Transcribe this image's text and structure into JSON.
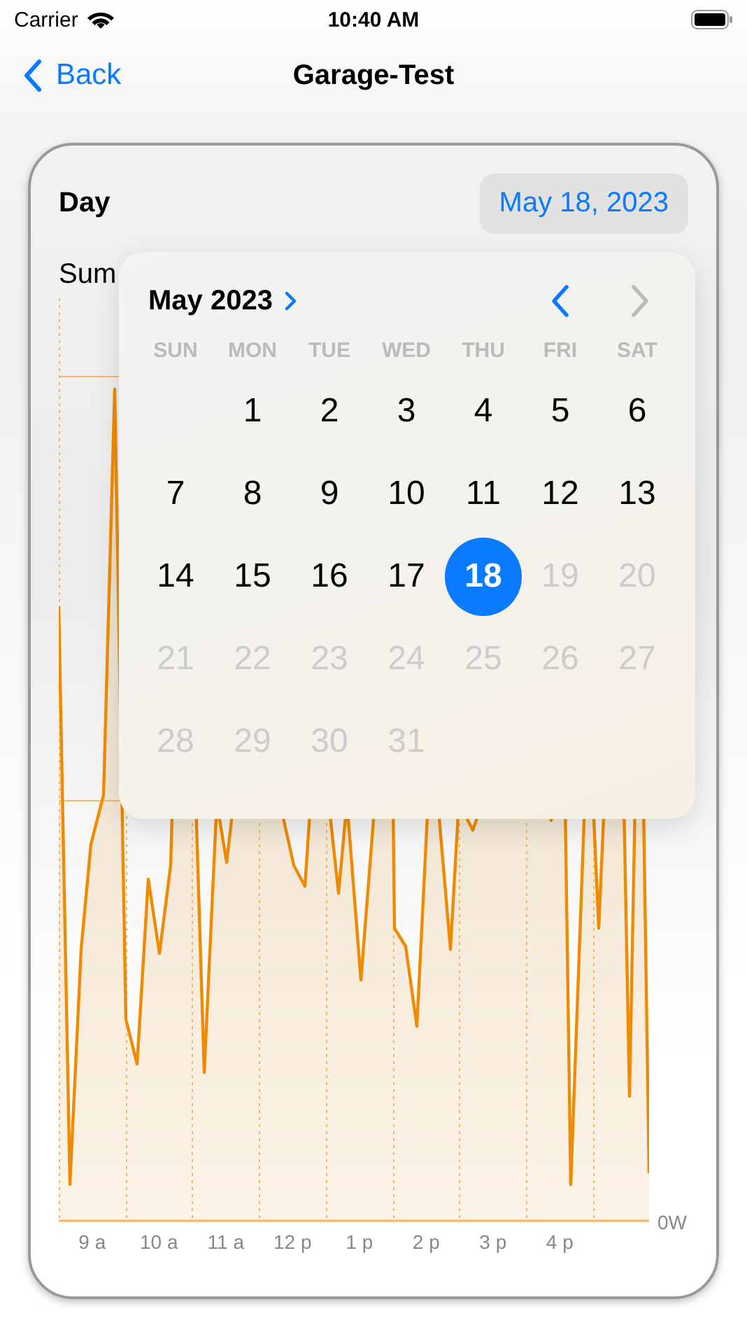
{
  "status_bar": {
    "carrier": "Carrier",
    "time": "10:40 AM"
  },
  "nav": {
    "back": "Back",
    "title": "Garage-Test"
  },
  "card": {
    "period_label": "Day",
    "date_button": "May 18, 2023",
    "summary_label": "Sum",
    "chart": {
      "x_labels": [
        "9 a",
        "10 a",
        "11 a",
        "12 p",
        "1 p",
        "2 p",
        "3 p",
        "4 p"
      ],
      "y_label": "0W"
    }
  },
  "calendar": {
    "month": "May 2023",
    "weekdays": [
      "SUN",
      "MON",
      "TUE",
      "WED",
      "THU",
      "FRI",
      "SAT"
    ],
    "weeks": [
      [
        {
          "label": "1",
          "selected": false,
          "disabled": false
        },
        {
          "label": "2",
          "selected": false,
          "disabled": false
        },
        {
          "label": "3",
          "selected": false,
          "disabled": false
        },
        {
          "label": "4",
          "selected": false,
          "disabled": false
        },
        {
          "label": "5",
          "selected": false,
          "disabled": false
        },
        {
          "label": "6",
          "selected": false,
          "disabled": false
        }
      ],
      [
        {
          "label": "7",
          "selected": false,
          "disabled": false
        },
        {
          "label": "8",
          "selected": false,
          "disabled": false
        },
        {
          "label": "9",
          "selected": false,
          "disabled": false
        },
        {
          "label": "10",
          "selected": false,
          "disabled": false
        },
        {
          "label": "11",
          "selected": false,
          "disabled": false
        },
        {
          "label": "12",
          "selected": false,
          "disabled": false
        },
        {
          "label": "13",
          "selected": false,
          "disabled": false
        }
      ],
      [
        {
          "label": "14",
          "selected": false,
          "disabled": false
        },
        {
          "label": "15",
          "selected": false,
          "disabled": false
        },
        {
          "label": "16",
          "selected": false,
          "disabled": false
        },
        {
          "label": "17",
          "selected": false,
          "disabled": false
        },
        {
          "label": "18",
          "selected": true,
          "disabled": false
        },
        {
          "label": "19",
          "selected": false,
          "disabled": true
        },
        {
          "label": "20",
          "selected": false,
          "disabled": true
        }
      ],
      [
        {
          "label": "21",
          "selected": false,
          "disabled": true
        },
        {
          "label": "22",
          "selected": false,
          "disabled": true
        },
        {
          "label": "23",
          "selected": false,
          "disabled": true
        },
        {
          "label": "24",
          "selected": false,
          "disabled": true
        },
        {
          "label": "25",
          "selected": false,
          "disabled": true
        },
        {
          "label": "26",
          "selected": false,
          "disabled": true
        },
        {
          "label": "27",
          "selected": false,
          "disabled": true
        }
      ],
      [
        {
          "label": "28",
          "selected": false,
          "disabled": true
        },
        {
          "label": "29",
          "selected": false,
          "disabled": true
        },
        {
          "label": "30",
          "selected": false,
          "disabled": true
        },
        {
          "label": "31",
          "selected": false,
          "disabled": true
        }
      ]
    ],
    "prev_disabled": false,
    "next_disabled": true
  }
}
